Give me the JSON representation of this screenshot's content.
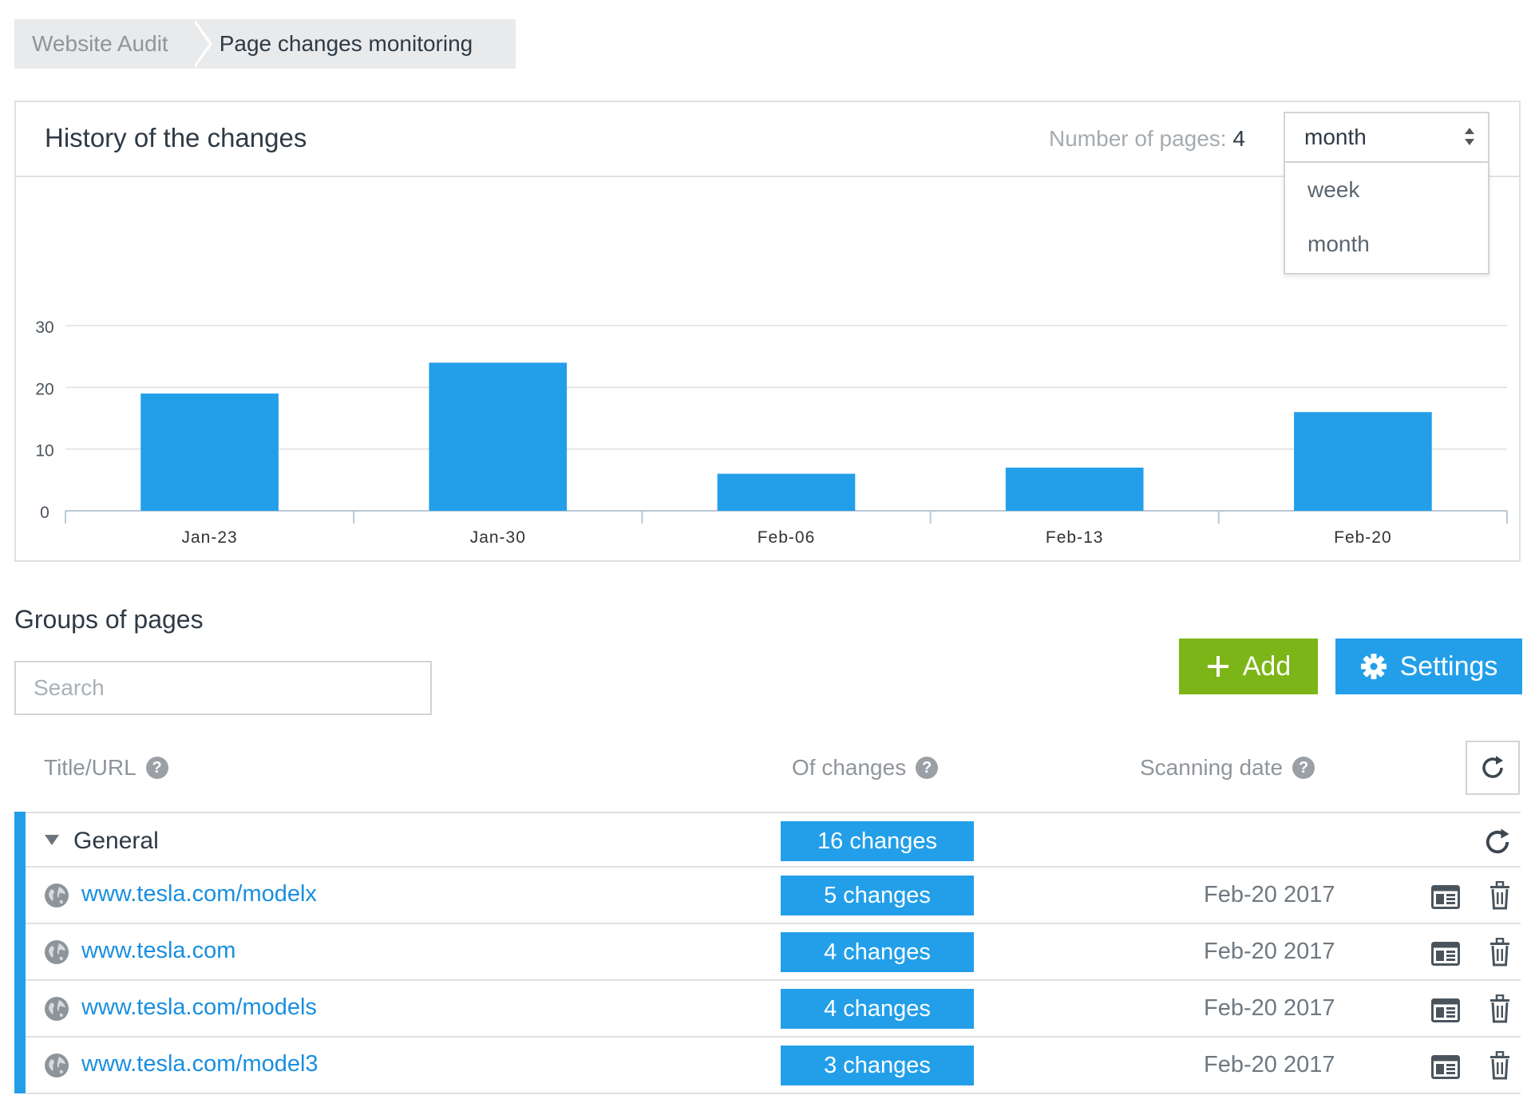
{
  "breadcrumb": {
    "items": [
      "Website Audit",
      "Page changes monitoring"
    ]
  },
  "history": {
    "title": "History of the changes",
    "pages_label": "Number of pages:",
    "pages_count": "4",
    "period_selected": "month",
    "period_options": [
      "week",
      "month"
    ]
  },
  "chart_data": {
    "type": "bar",
    "categories": [
      "Jan-23",
      "Jan-30",
      "Feb-06",
      "Feb-13",
      "Feb-20"
    ],
    "values": [
      19,
      24,
      6,
      7,
      16
    ],
    "y_ticks": [
      0,
      10,
      20,
      30
    ],
    "ylim": [
      0,
      30
    ],
    "color": "#239fe9",
    "grid": true
  },
  "groups": {
    "title": "Groups of pages",
    "search_placeholder": "Search",
    "add_label": "Add",
    "settings_label": "Settings",
    "columns": {
      "title_url": "Title/URL",
      "changes": "Of changes",
      "scanning_date": "Scanning date"
    },
    "group": {
      "name": "General",
      "changes": "16 changes"
    },
    "rows": [
      {
        "url": "www.tesla.com/modelx",
        "changes": "5 changes",
        "date": "Feb-20 2017"
      },
      {
        "url": "www.tesla.com",
        "changes": "4 changes",
        "date": "Feb-20 2017"
      },
      {
        "url": "www.tesla.com/models",
        "changes": "4 changes",
        "date": "Feb-20 2017"
      },
      {
        "url": "www.tesla.com/model3",
        "changes": "3 changes",
        "date": "Feb-20 2017"
      }
    ]
  },
  "icons": {
    "add": "plus-icon",
    "settings": "gear-icon",
    "help": "question-icon",
    "refresh": "refresh-icon",
    "page": "globe-icon",
    "report": "report-icon",
    "delete": "trash-icon",
    "collapse": "caret-down-icon",
    "select": "select-arrows-icon"
  },
  "colors": {
    "accent": "#239fe9",
    "add_button": "#7cb518",
    "link": "#1a8fdf"
  }
}
